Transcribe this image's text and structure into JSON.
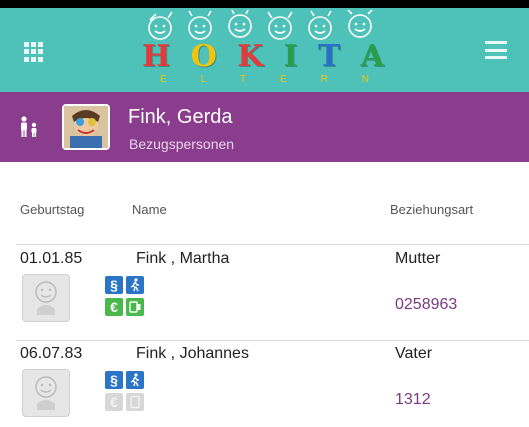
{
  "app": {
    "logo_letters": [
      "H",
      "O",
      "K",
      "I",
      "T",
      "A"
    ],
    "logo_colors": [
      "#e23b3b",
      "#f1c40f",
      "#e23b3b",
      "#2a9d4a",
      "#2a6fc7",
      "#2a9d4a"
    ],
    "logo_sub": [
      "E",
      "L",
      "T",
      "E",
      "R",
      "N"
    ],
    "grid_icon": "apps-grid-icon",
    "menu_icon": "hamburger-menu-icon"
  },
  "profile": {
    "name": "Fink, Gerda",
    "subtitle": "Bezugspersonen",
    "icon": "parent-child-icon"
  },
  "table": {
    "columns": [
      "Geburtstag",
      "Name",
      "Beziehungsart"
    ],
    "rows": [
      {
        "birthday": "01.01.85",
        "name": "Fink , Martha",
        "relation": "Mutter",
        "number": "0258963",
        "badges": [
          "paragraph-icon",
          "pickup-person-icon",
          "euro-icon",
          "phone-card-icon"
        ],
        "badges_active": [
          true,
          true,
          true,
          true
        ]
      },
      {
        "birthday": "06.07.83",
        "name": "Fink , Johannes",
        "relation": "Vater",
        "number": "1312",
        "badges": [
          "paragraph-icon",
          "pickup-person-icon",
          "euro-icon",
          "phone-card-icon"
        ],
        "badges_active": [
          true,
          true,
          false,
          false
        ]
      }
    ]
  },
  "colors": {
    "appbar": "#4ec1b9",
    "profile_bar": "#8a3d8d",
    "badge_blue": "#2a75c7",
    "badge_green": "#48b94a",
    "number_purple": "#7a3a80"
  }
}
